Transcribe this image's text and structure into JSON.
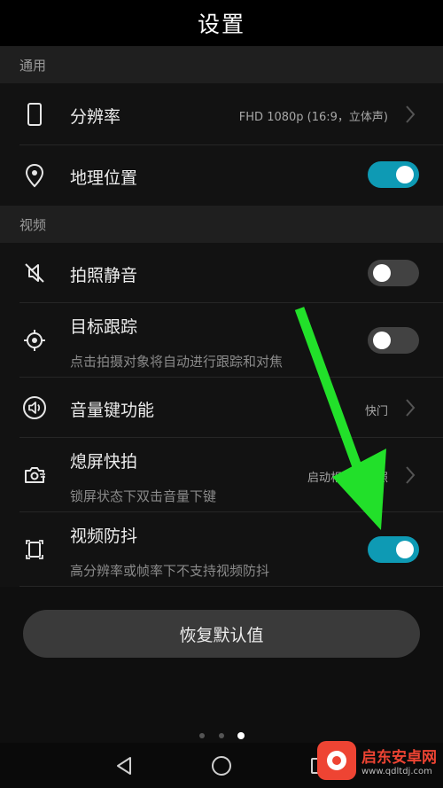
{
  "header": {
    "title": "设置"
  },
  "sections": {
    "general": {
      "label": "通用"
    },
    "video": {
      "label": "视频"
    }
  },
  "rows": {
    "resolution": {
      "title": "分辨率",
      "value": "FHD 1080p (16:9，立体声)",
      "icon": "phone-outline-icon"
    },
    "location": {
      "title": "地理位置",
      "toggle": true,
      "icon": "location-pin-icon"
    },
    "mute_shutter": {
      "title": "拍照静音",
      "toggle": false,
      "icon": "speaker-mute-icon"
    },
    "tracking": {
      "title": "目标跟踪",
      "subtitle": "点击拍摄对象将自动进行跟踪和对焦",
      "toggle": false,
      "icon": "target-icon"
    },
    "volume_key": {
      "title": "音量键功能",
      "value": "快门",
      "icon": "volume-key-icon"
    },
    "quick_snap": {
      "title": "熄屏快拍",
      "subtitle": "锁屏状态下双击音量下键",
      "value": "启动相机并拍照",
      "icon": "camera-quick-icon"
    },
    "stabilization": {
      "title": "视频防抖",
      "subtitle": "高分辨率或帧率下不支持视频防抖",
      "toggle": true,
      "icon": "stabilize-icon"
    }
  },
  "reset_button": {
    "label": "恢复默认值"
  },
  "page_indicator": {
    "count": 3,
    "active": 3
  },
  "watermark": {
    "name": "启东安卓网",
    "url": "www.qdltdj.com"
  },
  "colors": {
    "accent": "#0e9ab4",
    "arrow": "#22e02a",
    "background": "#121212"
  }
}
